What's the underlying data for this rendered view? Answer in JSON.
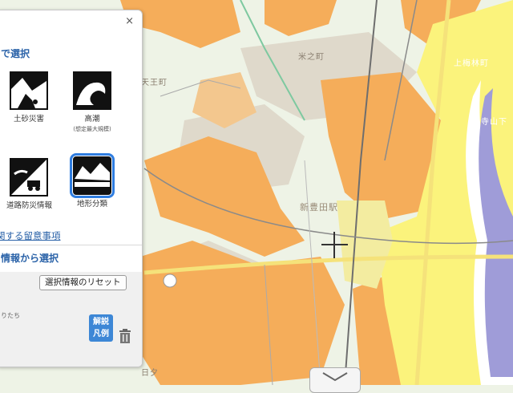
{
  "map": {
    "labels": {
      "tennoucho": "天王町",
      "yonemachi": "米之町",
      "kamiumebayashi": "上梅林町",
      "terayamashita": "寺山下",
      "shinkatsuta_station": "新豊田駅",
      "yuta": "日夕"
    },
    "colors": {
      "land": "#eef3e6",
      "orange": "#f5ad5a",
      "light_orange": "#f3c78e",
      "yellow": "#fbf37c",
      "gray_urban": "#ddd6c8",
      "river": "#9f9cd8",
      "river_edge": "#ffffff"
    }
  },
  "panel": {
    "close_label": "×",
    "section_title": "で選択",
    "tiles": [
      {
        "label": "土砂災害",
        "icon": "landslide-icon"
      },
      {
        "label": "高潮",
        "sublabel": "(想定最大規模)",
        "icon": "storm-surge-icon"
      },
      {
        "label": "道路防災情報",
        "icon": "road-disaster-icon"
      },
      {
        "label": "地形分類",
        "icon": "terrain-classification-icon",
        "selected": true
      }
    ],
    "notes_link": "関する留意事項",
    "section2_title": "情報から選択",
    "reset_button": "選択情報のリセット",
    "small_note": "りたち",
    "legend_button": "解説凡例",
    "legend_line1": "解説",
    "legend_line2": "凡例"
  }
}
